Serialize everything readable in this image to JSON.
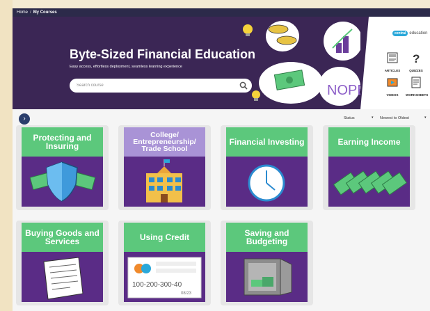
{
  "breadcrumb": {
    "home": "Home",
    "separator": "/",
    "current": "My Courses"
  },
  "hero": {
    "title": "Byte-Sized Financial Education",
    "subtitle": "Easy access, effortless deployment, seamless learning experience",
    "search_placeholder": "Search course",
    "art_text_nope": "NOPE"
  },
  "brand": {
    "badge": "central",
    "label": "education"
  },
  "resources": [
    {
      "label": "ARTICLES",
      "icon": "articles-icon"
    },
    {
      "label": "QUIZZES",
      "icon": "quizzes-icon"
    },
    {
      "label": "VIDEOS",
      "icon": "videos-icon"
    },
    {
      "label": "WORKSHEETS",
      "icon": "worksheets-icon"
    }
  ],
  "controls": {
    "nav_symbol": "›",
    "status_label": "Status",
    "sort_label": "Newest to Oldest",
    "caret": "▾"
  },
  "courses": [
    {
      "title": "Protecting and Insuring",
      "icon": "shield-money-icon"
    },
    {
      "title": "College/ Entrepreneurship/ Trade School",
      "icon": "school-building-icon"
    },
    {
      "title": "Financial Investing",
      "icon": "clock-icon"
    },
    {
      "title": "Earning Income",
      "icon": "money-stack-icon"
    },
    {
      "title": "Buying Goods and Services",
      "icon": "receipt-icon"
    },
    {
      "title": "Using Credit",
      "icon": "credit-card-icon",
      "card_number": "100-200-300-40",
      "card_expiry": "08/23"
    },
    {
      "title": "Saving and Budgeting",
      "icon": "safe-icon"
    }
  ],
  "colors": {
    "header": "#3b2655",
    "tile_green": "#5cc87c",
    "tile_purple": "#a993d6",
    "art_purple": "#5a2c86",
    "breadcrumb": "#2c2a4a"
  }
}
